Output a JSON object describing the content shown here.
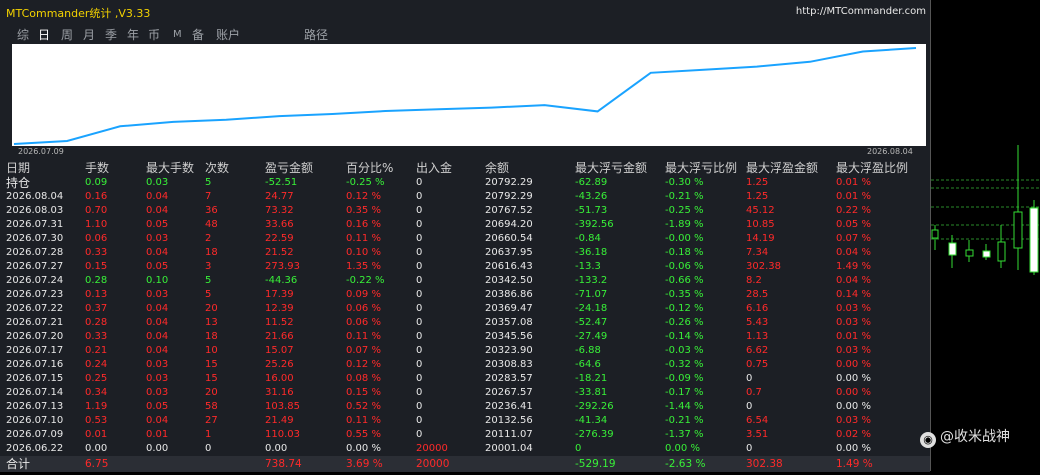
{
  "window": {
    "title": "MTCommander统计 ,V3.33",
    "url": "http://MTCommander.com"
  },
  "tabs": [
    {
      "label": "综",
      "active": false
    },
    {
      "label": "日",
      "active": true
    },
    {
      "label": "周",
      "active": false
    },
    {
      "label": "月",
      "active": false
    },
    {
      "label": "季",
      "active": false
    },
    {
      "label": "年",
      "active": false
    },
    {
      "label": "币",
      "active": false
    },
    {
      "label": "M",
      "active": false
    },
    {
      "label": "备",
      "active": false
    },
    {
      "label": "账户",
      "active": false
    },
    {
      "label": "路径",
      "active": false
    }
  ],
  "balance_chart": {
    "start_date": "2026.07.09",
    "end_date": "2026.08.04",
    "line_color": "#1aa3ff"
  },
  "chart_data": {
    "type": "line",
    "title": "",
    "xlabel": "",
    "ylabel": "",
    "x": [
      "2026.07.09",
      "2026.07.10",
      "2026.07.13",
      "2026.07.14",
      "2026.07.15",
      "2026.07.16",
      "2026.07.17",
      "2026.07.20",
      "2026.07.21",
      "2026.07.22",
      "2026.07.23",
      "2026.07.24",
      "2026.07.27",
      "2026.07.28",
      "2026.07.30",
      "2026.07.31",
      "2026.08.03",
      "2026.08.04"
    ],
    "series": [
      {
        "name": "",
        "values": [
          20111.07,
          20132.56,
          20236.41,
          20267.57,
          20283.57,
          20308.83,
          20323.9,
          20345.56,
          20357.08,
          20369.47,
          20386.86,
          20342.5,
          20616.43,
          20637.95,
          20660.54,
          20694.2,
          20767.52,
          20792.29
        ]
      }
    ]
  },
  "table": {
    "headers": [
      "日期",
      "手数",
      "最大手数",
      "次数",
      "盈亏金额",
      "百分比%",
      "出入金",
      "余额",
      "最大浮亏金额",
      "最大浮亏比例",
      "最大浮盈金额",
      "最大浮盈比例"
    ],
    "holding": {
      "date": "持仓",
      "lots": "0.09",
      "max_lots": "0.03",
      "count": "5",
      "pnl": "-52.51",
      "pct": "-0.25 %",
      "deposit": "0",
      "balance": "20792.29",
      "max_dd": "-62.89",
      "max_dd_pct": "-0.30 %",
      "max_fp": "1.25",
      "max_fp_pct": "0.01 %"
    },
    "rows": [
      {
        "date": "2026.08.04",
        "lots": "0.16",
        "max_lots": "0.04",
        "count": "7",
        "pnl": "24.77",
        "pct": "0.12 %",
        "deposit": "0",
        "balance": "20792.29",
        "max_dd": "-43.26",
        "max_dd_pct": "-0.21 %",
        "max_fp": "1.25",
        "max_fp_pct": "0.01 %"
      },
      {
        "date": "2026.08.03",
        "lots": "0.70",
        "max_lots": "0.04",
        "count": "36",
        "pnl": "73.32",
        "pct": "0.35 %",
        "deposit": "0",
        "balance": "20767.52",
        "max_dd": "-51.73",
        "max_dd_pct": "-0.25 %",
        "max_fp": "45.12",
        "max_fp_pct": "0.22 %"
      },
      {
        "date": "2026.07.31",
        "lots": "1.10",
        "max_lots": "0.05",
        "count": "48",
        "pnl": "33.66",
        "pct": "0.16 %",
        "deposit": "0",
        "balance": "20694.20",
        "max_dd": "-392.56",
        "max_dd_pct": "-1.89 %",
        "max_fp": "10.85",
        "max_fp_pct": "0.05 %"
      },
      {
        "date": "2026.07.30",
        "lots": "0.06",
        "max_lots": "0.03",
        "count": "2",
        "pnl": "22.59",
        "pct": "0.11 %",
        "deposit": "0",
        "balance": "20660.54",
        "max_dd": "-0.84",
        "max_dd_pct": "-0.00 %",
        "max_fp": "14.19",
        "max_fp_pct": "0.07 %"
      },
      {
        "date": "2026.07.28",
        "lots": "0.33",
        "max_lots": "0.04",
        "count": "18",
        "pnl": "21.52",
        "pct": "0.10 %",
        "deposit": "0",
        "balance": "20637.95",
        "max_dd": "-36.18",
        "max_dd_pct": "-0.18 %",
        "max_fp": "7.34",
        "max_fp_pct": "0.04 %"
      },
      {
        "date": "2026.07.27",
        "lots": "0.15",
        "max_lots": "0.05",
        "count": "3",
        "pnl": "273.93",
        "pct": "1.35 %",
        "deposit": "0",
        "balance": "20616.43",
        "max_dd": "-13.3",
        "max_dd_pct": "-0.06 %",
        "max_fp": "302.38",
        "max_fp_pct": "1.49 %"
      },
      {
        "date": "2026.07.24",
        "lots": "0.28",
        "max_lots": "0.10",
        "count": "5",
        "pnl": "-44.36",
        "pct": "-0.22 %",
        "deposit": "0",
        "balance": "20342.50",
        "max_dd": "-133.2",
        "max_dd_pct": "-0.66 %",
        "max_fp": "8.2",
        "max_fp_pct": "0.04 %",
        "loss": true
      },
      {
        "date": "2026.07.23",
        "lots": "0.13",
        "max_lots": "0.03",
        "count": "5",
        "pnl": "17.39",
        "pct": "0.09 %",
        "deposit": "0",
        "balance": "20386.86",
        "max_dd": "-71.07",
        "max_dd_pct": "-0.35 %",
        "max_fp": "28.5",
        "max_fp_pct": "0.14 %"
      },
      {
        "date": "2026.07.22",
        "lots": "0.37",
        "max_lots": "0.04",
        "count": "20",
        "pnl": "12.39",
        "pct": "0.06 %",
        "deposit": "0",
        "balance": "20369.47",
        "max_dd": "-24.18",
        "max_dd_pct": "-0.12 %",
        "max_fp": "6.16",
        "max_fp_pct": "0.03 %"
      },
      {
        "date": "2026.07.21",
        "lots": "0.28",
        "max_lots": "0.04",
        "count": "13",
        "pnl": "11.52",
        "pct": "0.06 %",
        "deposit": "0",
        "balance": "20357.08",
        "max_dd": "-52.47",
        "max_dd_pct": "-0.26 %",
        "max_fp": "5.43",
        "max_fp_pct": "0.03 %"
      },
      {
        "date": "2026.07.20",
        "lots": "0.33",
        "max_lots": "0.04",
        "count": "18",
        "pnl": "21.66",
        "pct": "0.11 %",
        "deposit": "0",
        "balance": "20345.56",
        "max_dd": "-27.49",
        "max_dd_pct": "-0.14 %",
        "max_fp": "1.13",
        "max_fp_pct": "0.01 %"
      },
      {
        "date": "2026.07.17",
        "lots": "0.21",
        "max_lots": "0.04",
        "count": "10",
        "pnl": "15.07",
        "pct": "0.07 %",
        "deposit": "0",
        "balance": "20323.90",
        "max_dd": "-6.88",
        "max_dd_pct": "-0.03 %",
        "max_fp": "6.62",
        "max_fp_pct": "0.03 %"
      },
      {
        "date": "2026.07.16",
        "lots": "0.24",
        "max_lots": "0.03",
        "count": "15",
        "pnl": "25.26",
        "pct": "0.12 %",
        "deposit": "0",
        "balance": "20308.83",
        "max_dd": "-64.6",
        "max_dd_pct": "-0.32 %",
        "max_fp": "0.75",
        "max_fp_pct": "0.00 %"
      },
      {
        "date": "2026.07.15",
        "lots": "0.25",
        "max_lots": "0.03",
        "count": "15",
        "pnl": "16.00",
        "pct": "0.08 %",
        "deposit": "0",
        "balance": "20283.57",
        "max_dd": "-18.21",
        "max_dd_pct": "-0.09 %",
        "max_fp": "0",
        "max_fp_pct": "0.00 %"
      },
      {
        "date": "2026.07.14",
        "lots": "0.34",
        "max_lots": "0.03",
        "count": "20",
        "pnl": "31.16",
        "pct": "0.15 %",
        "deposit": "0",
        "balance": "20267.57",
        "max_dd": "-33.81",
        "max_dd_pct": "-0.17 %",
        "max_fp": "0.7",
        "max_fp_pct": "0.00 %"
      },
      {
        "date": "2026.07.13",
        "lots": "1.19",
        "max_lots": "0.05",
        "count": "58",
        "pnl": "103.85",
        "pct": "0.52 %",
        "deposit": "0",
        "balance": "20236.41",
        "max_dd": "-292.26",
        "max_dd_pct": "-1.44 %",
        "max_fp": "0",
        "max_fp_pct": "0.00 %"
      },
      {
        "date": "2026.07.10",
        "lots": "0.53",
        "max_lots": "0.04",
        "count": "27",
        "pnl": "21.49",
        "pct": "0.11 %",
        "deposit": "0",
        "balance": "20132.56",
        "max_dd": "-41.34",
        "max_dd_pct": "-0.21 %",
        "max_fp": "6.54",
        "max_fp_pct": "0.03 %"
      },
      {
        "date": "2026.07.09",
        "lots": "0.01",
        "max_lots": "0.01",
        "count": "1",
        "pnl": "110.03",
        "pct": "0.55 %",
        "deposit": "0",
        "balance": "20111.07",
        "max_dd": "-276.39",
        "max_dd_pct": "-1.37 %",
        "max_fp": "3.51",
        "max_fp_pct": "0.02 %"
      },
      {
        "date": "2026.06.22",
        "lots": "0.00",
        "max_lots": "0.00",
        "count": "0",
        "pnl": "0.00",
        "pct": "0.00 %",
        "deposit": "20000",
        "balance": "20001.04",
        "max_dd": "0",
        "max_dd_pct": "0.00 %",
        "max_fp": "0",
        "max_fp_pct": "0.00 %",
        "initial": true
      }
    ],
    "total": {
      "date": "合计",
      "lots": "6.75",
      "max_lots": "",
      "count": "",
      "pnl": "738.74",
      "pct": "3.69 %",
      "deposit": "20000",
      "balance": "",
      "max_dd": "-529.19",
      "max_dd_pct": "-2.63 %",
      "max_fp": "302.38",
      "max_fp_pct": "1.49 %"
    }
  },
  "watermark": {
    "icon": "weibo-icon",
    "text": "@收米战神"
  }
}
